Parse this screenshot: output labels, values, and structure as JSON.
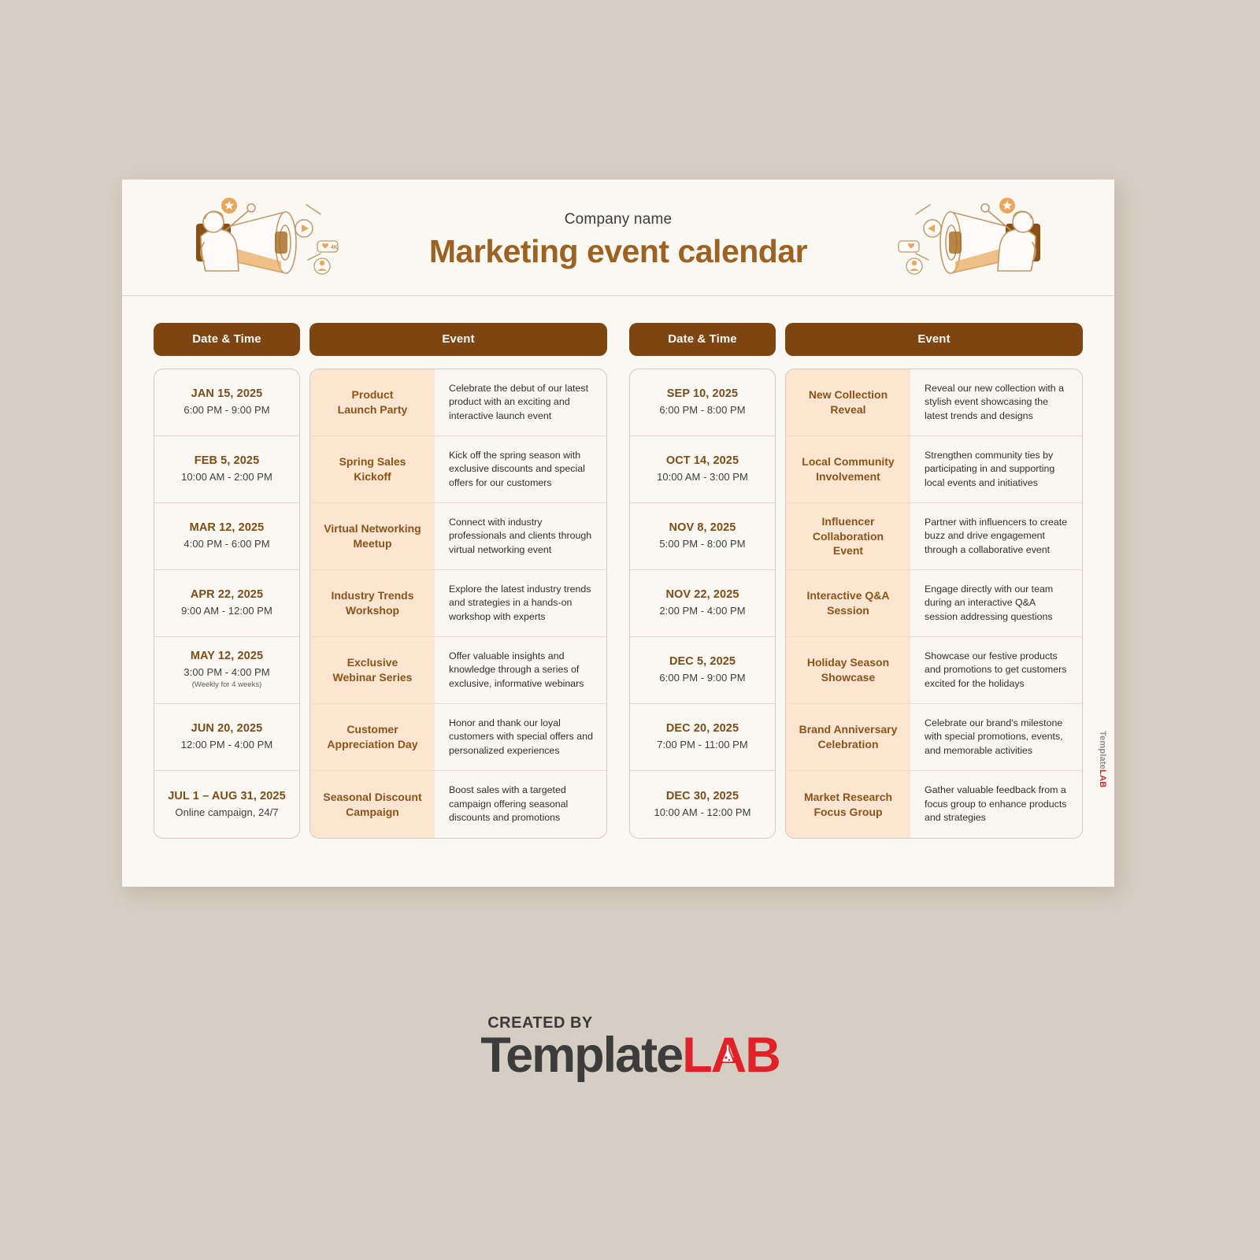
{
  "page": {
    "background_color": "#d7cec3",
    "card_color": "#faf8f3"
  },
  "header": {
    "company_name": "Company name",
    "title": "Marketing event calendar",
    "title_color": "#9c6224",
    "illustration_left": "megaphone-person-illustration",
    "illustration_right": "megaphone-person-illustration-mirrored"
  },
  "columns": {
    "date_header": "Date & Time",
    "event_header": "Event",
    "header_bg": "#7d4511",
    "event_name_bg": "#fce6d2"
  },
  "tables": [
    {
      "id": "left-table",
      "rows": [
        {
          "date": "JAN 15, 2025",
          "time": "6:00 PM - 9:00 PM",
          "note": "",
          "name": "Product\nLaunch Party",
          "desc": "Celebrate the debut of our latest product with an exciting and interactive launch event"
        },
        {
          "date": "FEB 5, 2025",
          "time": "10:00 AM - 2:00 PM",
          "note": "",
          "name": "Spring Sales\nKickoff",
          "desc": "Kick off the spring season with exclusive discounts and special offers for our customers"
        },
        {
          "date": "MAR 12, 2025",
          "time": "4:00 PM - 6:00 PM",
          "note": "",
          "name": "Virtual Networking\nMeetup",
          "desc": "Connect with industry professionals and clients through virtual networking event"
        },
        {
          "date": "APR 22, 2025",
          "time": "9:00 AM - 12:00 PM",
          "note": "",
          "name": "Industry Trends\nWorkshop",
          "desc": "Explore the latest industry trends and strategies in a hands-on workshop with experts"
        },
        {
          "date": "MAY 12, 2025",
          "time": "3:00 PM - 4:00 PM",
          "note": "(Weekly for 4 weeks)",
          "name": "Exclusive\nWebinar Series",
          "desc": "Offer valuable insights and knowledge through a series of exclusive, informative webinars"
        },
        {
          "date": "JUN 20, 2025",
          "time": "12:00 PM - 4:00 PM",
          "note": "",
          "name": "Customer\nAppreciation Day",
          "desc": "Honor and thank our loyal customers with special offers and personalized experiences"
        },
        {
          "date": "JUL 1 – AUG 31, 2025",
          "time": "Online campaign, 24/7",
          "note": "",
          "name": "Seasonal Discount\nCampaign",
          "desc": "Boost sales with a targeted campaign offering seasonal discounts and promotions"
        }
      ]
    },
    {
      "id": "right-table",
      "rows": [
        {
          "date": "SEP 10, 2025",
          "time": "6:00 PM - 8:00 PM",
          "note": "",
          "name": "New Collection\nReveal",
          "desc": "Reveal our new collection with a stylish event showcasing the latest trends and designs"
        },
        {
          "date": "OCT 14, 2025",
          "time": "10:00 AM - 3:00 PM",
          "note": "",
          "name": "Local Community\nInvolvement",
          "desc": "Strengthen community ties by participating in and supporting local events and initiatives"
        },
        {
          "date": "NOV 8, 2025",
          "time": "5:00 PM - 8:00 PM",
          "note": "",
          "name": "Influencer\nCollaboration\nEvent",
          "desc": "Partner with influencers to create buzz and drive engagement through a collaborative event"
        },
        {
          "date": "NOV 22, 2025",
          "time": "2:00 PM - 4:00 PM",
          "note": "",
          "name": "Interactive Q&A\nSession",
          "desc": "Engage directly with our team during an interactive Q&A session addressing questions"
        },
        {
          "date": "DEC 5, 2025",
          "time": "6:00 PM - 9:00 PM",
          "note": "",
          "name": "Holiday Season\nShowcase",
          "desc": "Showcase our festive products and promotions to get customers excited for the holidays"
        },
        {
          "date": "DEC 20, 2025",
          "time": "7:00 PM - 11:00 PM",
          "note": "",
          "name": "Brand Anniversary\nCelebration",
          "desc": "Celebrate our brand's milestone with special promotions, events, and memorable activities"
        },
        {
          "date": "DEC 30, 2025",
          "time": "10:00 AM - 12:00 PM",
          "note": "",
          "name": "Market Research\nFocus Group",
          "desc": "Gather valuable feedback from a focus group to enhance products and strategies"
        }
      ]
    }
  ],
  "watermark": {
    "part_one": "Template",
    "part_two": "LAB",
    "color_one": "#8d8d8d",
    "color_two": "#e02127"
  },
  "footer": {
    "created_by": "CREATED BY",
    "brand_one": "Template",
    "brand_two": "L",
    "brand_three": "A",
    "brand_four": "B",
    "dark_color": "#3c3c3c",
    "red_color": "#e02127"
  }
}
